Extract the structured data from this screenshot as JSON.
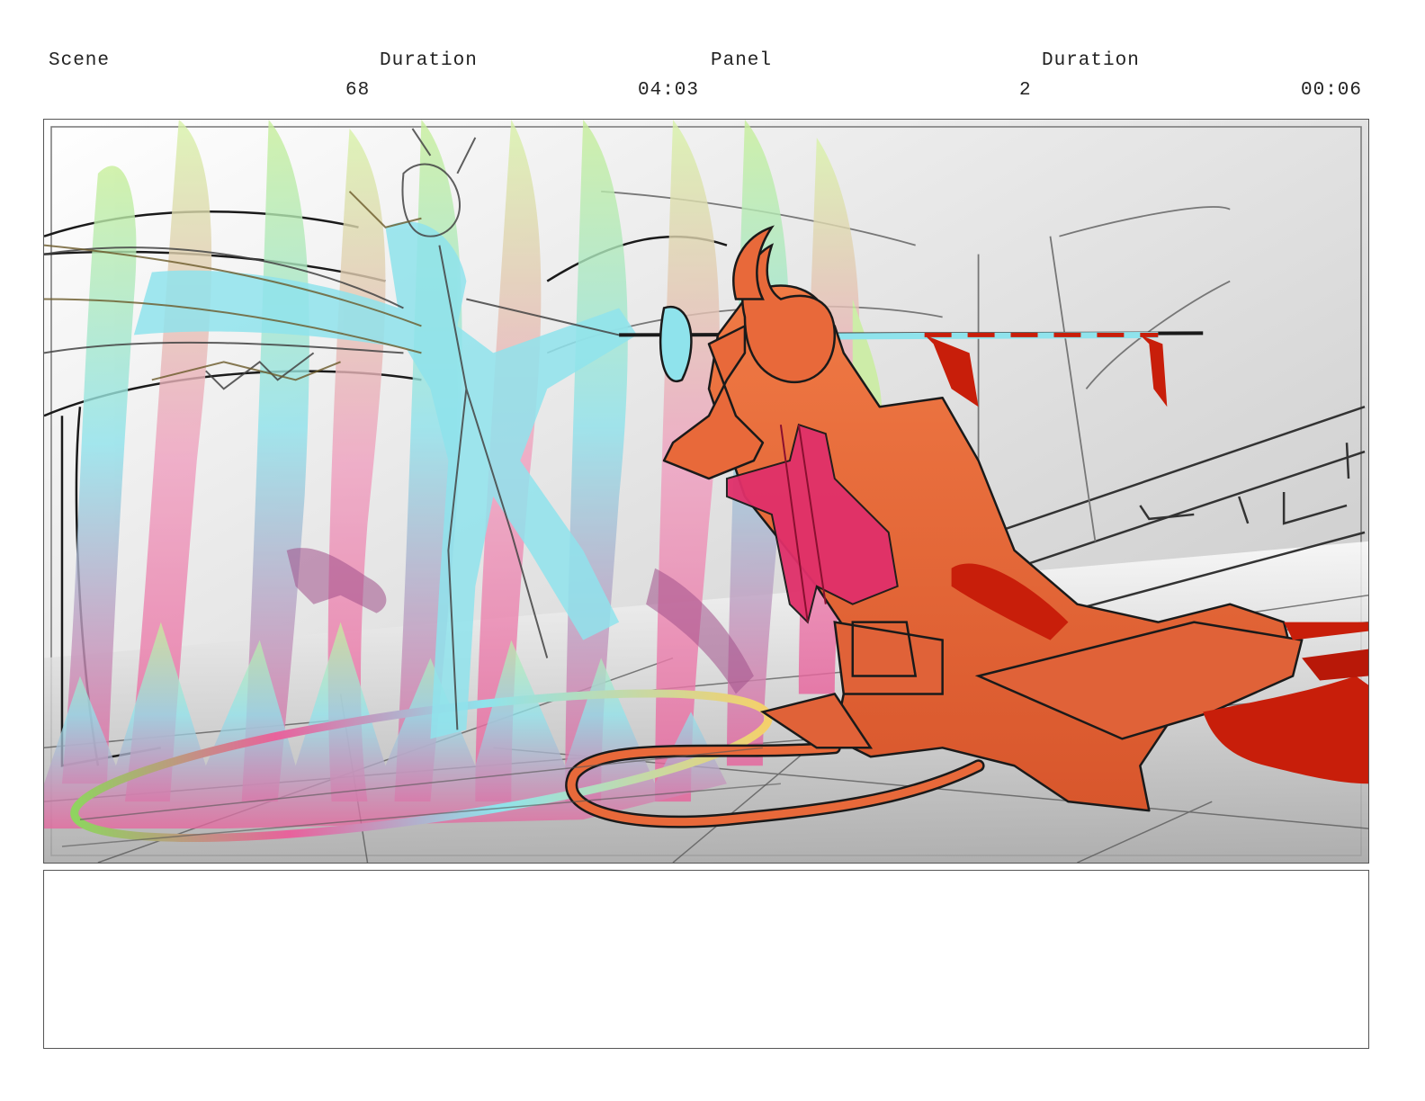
{
  "header": {
    "scene_label": "Scene",
    "scene_duration_label": "Duration",
    "panel_label": "Panel",
    "panel_duration_label": "Duration",
    "scene_value": "68",
    "scene_duration_value": "04:03",
    "panel_value": "2",
    "panel_duration_value": "00:06"
  },
  "panel": {
    "image_name": "storyboard-artwork",
    "colors": {
      "demon": "#e8693a",
      "demon_outline": "#1a1a1a",
      "blood": "#c81e0a",
      "scarf": "#e0306a",
      "spirit_cyan": "#8fe3ec",
      "spirit_green": "#c8ef9a",
      "spirit_pink": "#e8629c",
      "floor_gray": "#bdbdbd"
    }
  },
  "notes": {
    "text": ""
  }
}
